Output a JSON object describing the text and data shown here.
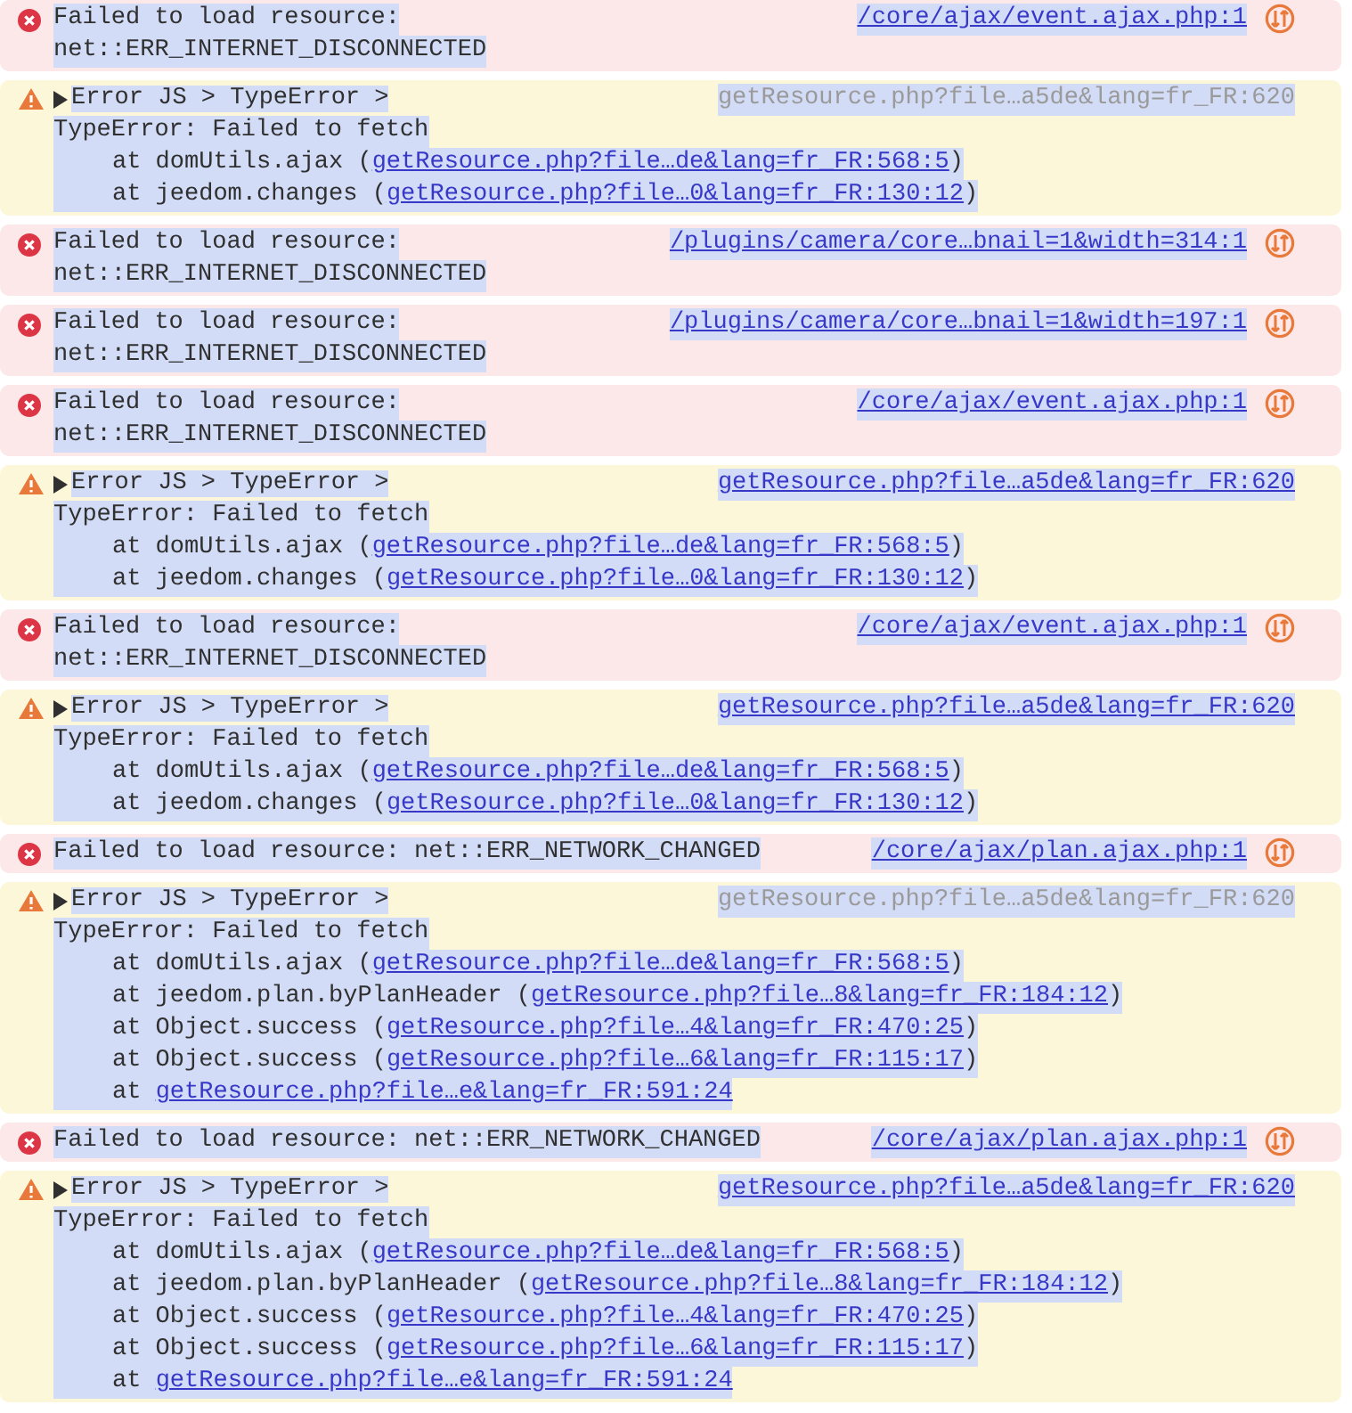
{
  "messages": [
    {
      "kind": "error",
      "selected": true,
      "lines": [
        "Failed to load resource:",
        "net::ERR_INTERNET_DISCONNECTED"
      ],
      "source": "/core/ajax/event.ajax.php:1",
      "source_linked": true,
      "network": true
    },
    {
      "kind": "warning",
      "selected": true,
      "summary": "Error JS > TypeError >",
      "source": "getResource.php?file…a5de&lang=fr_FR:620",
      "source_linked": false,
      "lines": [
        "TypeError: Failed to fetch"
      ],
      "stack": [
        {
          "text": "at domUtils.ajax (",
          "link": "getResource.php?file…de&lang=fr_FR:568:5",
          "suffix": ")"
        },
        {
          "text": "at jeedom.changes (",
          "link": "getResource.php?file…0&lang=fr_FR:130:12",
          "suffix": ")"
        }
      ]
    },
    {
      "kind": "error",
      "selected": true,
      "lines": [
        "Failed to load resource:",
        "net::ERR_INTERNET_DISCONNECTED"
      ],
      "source": "/plugins/camera/core…bnail=1&width=314:1",
      "source_linked": true,
      "network": true
    },
    {
      "kind": "error",
      "selected": true,
      "lines": [
        "Failed to load resource:",
        "net::ERR_INTERNET_DISCONNECTED"
      ],
      "source": "/plugins/camera/core…bnail=1&width=197:1",
      "source_linked": true,
      "network": true
    },
    {
      "kind": "error",
      "selected": true,
      "lines": [
        "Failed to load resource:",
        "net::ERR_INTERNET_DISCONNECTED"
      ],
      "source": "/core/ajax/event.ajax.php:1",
      "source_linked": true,
      "network": true
    },
    {
      "kind": "warning",
      "selected": true,
      "summary": "Error JS > TypeError >",
      "source": "getResource.php?file…a5de&lang=fr_FR:620",
      "source_linked": true,
      "lines": [
        "TypeError: Failed to fetch"
      ],
      "stack": [
        {
          "text": "at domUtils.ajax (",
          "link": "getResource.php?file…de&lang=fr_FR:568:5",
          "suffix": ")"
        },
        {
          "text": "at jeedom.changes (",
          "link": "getResource.php?file…0&lang=fr_FR:130:12",
          "suffix": ")"
        }
      ]
    },
    {
      "kind": "error",
      "selected": true,
      "lines": [
        "Failed to load resource:",
        "net::ERR_INTERNET_DISCONNECTED"
      ],
      "source": "/core/ajax/event.ajax.php:1",
      "source_linked": true,
      "network": true
    },
    {
      "kind": "warning",
      "selected": true,
      "summary": "Error JS > TypeError >",
      "source": "getResource.php?file…a5de&lang=fr_FR:620",
      "source_linked": true,
      "lines": [
        "TypeError: Failed to fetch"
      ],
      "stack": [
        {
          "text": "at domUtils.ajax (",
          "link": "getResource.php?file…de&lang=fr_FR:568:5",
          "suffix": ")"
        },
        {
          "text": "at jeedom.changes (",
          "link": "getResource.php?file…0&lang=fr_FR:130:12",
          "suffix": ")"
        }
      ]
    },
    {
      "kind": "error",
      "selected": true,
      "lines": [
        "Failed to load resource: net::ERR_NETWORK_CHANGED"
      ],
      "source": "/core/ajax/plan.ajax.php:1",
      "source_linked": true,
      "network": true
    },
    {
      "kind": "warning",
      "selected": true,
      "summary": "Error JS > TypeError >",
      "source": "getResource.php?file…a5de&lang=fr_FR:620",
      "source_linked": false,
      "lines": [
        "TypeError: Failed to fetch"
      ],
      "stack": [
        {
          "text": "at domUtils.ajax (",
          "link": "getResource.php?file…de&lang=fr_FR:568:5",
          "suffix": ")"
        },
        {
          "text": "at jeedom.plan.byPlanHeader (",
          "link": "getResource.php?file…8&lang=fr_FR:184:12",
          "suffix": ")"
        },
        {
          "text": "at Object.success (",
          "link": "getResource.php?file…4&lang=fr_FR:470:25",
          "suffix": ")"
        },
        {
          "text": "at Object.success (",
          "link": "getResource.php?file…6&lang=fr_FR:115:17",
          "suffix": ")"
        },
        {
          "text": "at ",
          "link": "getResource.php?file…e&lang=fr_FR:591:24"
        }
      ]
    },
    {
      "kind": "error",
      "selected": true,
      "lines": [
        "Failed to load resource: net::ERR_NETWORK_CHANGED"
      ],
      "source": "/core/ajax/plan.ajax.php:1",
      "source_linked": true,
      "network": true
    },
    {
      "kind": "warning",
      "selected": true,
      "summary": "Error JS > TypeError >",
      "source": "getResource.php?file…a5de&lang=fr_FR:620",
      "source_linked": true,
      "lines": [
        "TypeError: Failed to fetch"
      ],
      "stack": [
        {
          "text": "at domUtils.ajax (",
          "link": "getResource.php?file…de&lang=fr_FR:568:5",
          "suffix": ")"
        },
        {
          "text": "at jeedom.plan.byPlanHeader (",
          "link": "getResource.php?file…8&lang=fr_FR:184:12",
          "suffix": ")"
        },
        {
          "text": "at Object.success (",
          "link": "getResource.php?file…4&lang=fr_FR:470:25",
          "suffix": ")"
        },
        {
          "text": "at Object.success (",
          "link": "getResource.php?file…6&lang=fr_FR:115:17",
          "suffix": ")"
        },
        {
          "text": "at ",
          "link": "getResource.php?file…e&lang=fr_FR:591:24"
        }
      ]
    }
  ]
}
